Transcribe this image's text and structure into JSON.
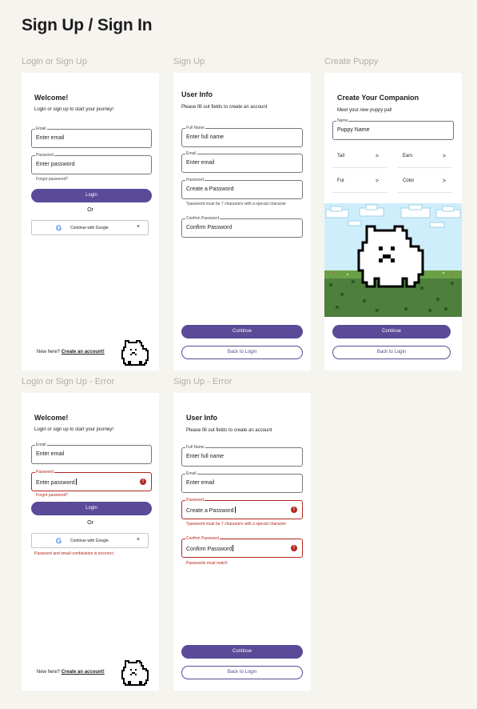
{
  "page_title": "Sign Up / Sign In",
  "frames": {
    "login": {
      "label": "Login or Sign Up",
      "heading": "Welcome!",
      "subtitle": "Login or sign up to start your journey!",
      "email_label": "Email",
      "email_value": "Enter email",
      "password_label": "Password",
      "password_value": "Enter password",
      "forgot": "Forgot password?",
      "login_button": "Login",
      "or": "Or",
      "google_g": "G",
      "google_text": "Continue with Google",
      "google_close": "×",
      "new_here": "New here?",
      "create_account": "Create an account!"
    },
    "signup": {
      "label": "Sign Up",
      "heading": "User Info",
      "subtitle": "Please fill out fields to create an account",
      "fullname_label": "Full Name",
      "fullname_value": "Enter full name",
      "email_label": "Email",
      "email_value": "Enter email",
      "password_label": "Password",
      "password_value": "Create a Password",
      "password_hint": "*password must be 7 characters with a special character",
      "confirm_label": "Confirm Password",
      "confirm_value": "Confirm Password",
      "continue_button": "Continue",
      "back_button": "Back to Login"
    },
    "puppy": {
      "label": "Create Puppy",
      "heading": "Create Your Companion",
      "subtitle": "Meet your new puppy pal!",
      "name_label": "Name",
      "name_value": "Puppy Name",
      "traits": [
        "Tail",
        "Ears",
        "Fur",
        "Color"
      ],
      "chevron": ">",
      "continue_button": "Continue",
      "back_button": "Back to Login"
    },
    "login_error": {
      "label": "Login or Sign Up - Error",
      "heading": "Welcome!",
      "subtitle": "Login or sign up to start your journey!",
      "email_label": "Email",
      "email_value": "Enter email",
      "password_label": "Password",
      "password_value": "Enter password",
      "error_icon": "!",
      "forgot": "Forgot password?",
      "login_button": "Login",
      "or": "Or",
      "google_g": "G",
      "google_text": "Continue with Google",
      "google_close": "×",
      "error_message": "Password and email combination is incorrect",
      "new_here": "New here?",
      "create_account": "Create an account!"
    },
    "signup_error": {
      "label": "Sign Up - Error",
      "heading": "User Info",
      "subtitle": "Please fill out fields to create an account",
      "fullname_label": "Full Name",
      "fullname_value": "Enter full name",
      "email_label": "Email",
      "email_value": "Enter email",
      "password_label": "Password",
      "password_value": "Create a Password",
      "error_icon": "!",
      "password_hint": "*password must be 7 characters with a special character",
      "confirm_label": "Confirm Password",
      "confirm_value": "Confirm Password",
      "match_error": "Passwords must match",
      "continue_button": "Continue",
      "back_button": "Back to Login"
    }
  },
  "colors": {
    "primary": "#5b4a97",
    "error": "#b3261e",
    "background": "#f5f4ee"
  }
}
